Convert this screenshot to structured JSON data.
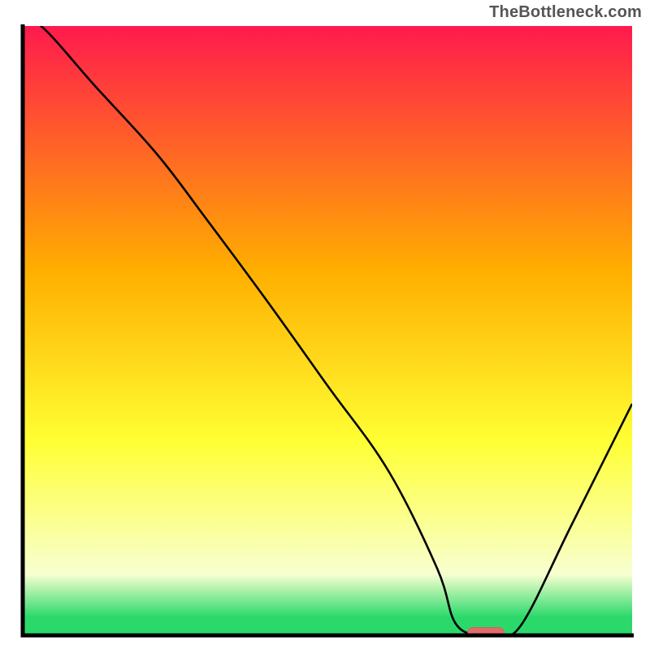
{
  "watermark": "TheBottleneck.com",
  "colors": {
    "axis": "#000000",
    "curve": "#000000",
    "marker_fill": "#e46a6a",
    "marker_stroke": "#c94f4f",
    "grad_top": "#ff1a4d",
    "grad_mid1": "#ffae00",
    "grad_mid2": "#ffff33",
    "grad_pale": "#f8ffd0",
    "grad_green": "#2bd96b"
  },
  "chart_data": {
    "type": "line",
    "title": "",
    "xlabel": "",
    "ylabel": "",
    "xlim": [
      0,
      100
    ],
    "ylim": [
      0,
      100
    ],
    "x": [
      0,
      3,
      12,
      22,
      30,
      40,
      50,
      60,
      68,
      71,
      75,
      78,
      82,
      90,
      100
    ],
    "values": [
      102,
      100,
      90,
      79,
      68.5,
      55,
      41,
      27,
      11,
      2,
      0,
      0,
      2,
      18,
      38
    ],
    "marker": {
      "x0": 73,
      "x1": 79,
      "y": 0.5
    },
    "annotations": []
  }
}
